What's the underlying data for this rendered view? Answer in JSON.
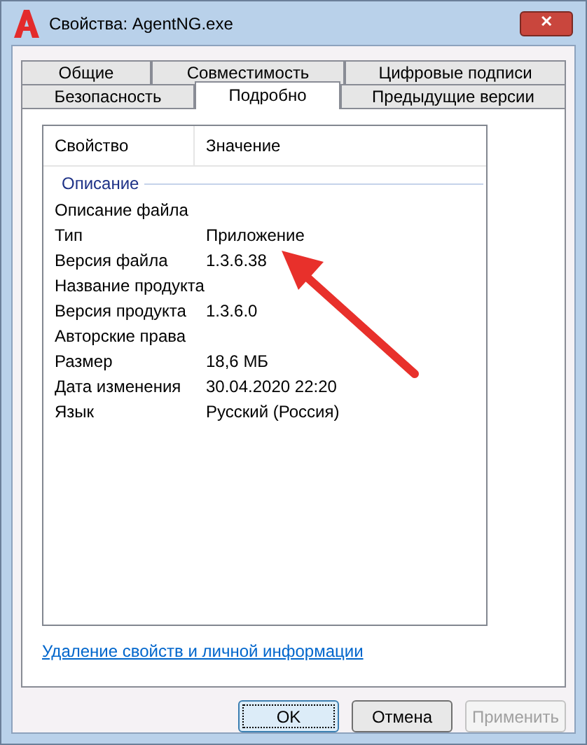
{
  "window": {
    "title": "Свойства: AgentNG.exe",
    "close": "✕"
  },
  "tab_rows": [
    [
      {
        "label": "Общие",
        "selected": false
      },
      {
        "label": "Совместимость",
        "selected": false
      },
      {
        "label": "Цифровые подписи",
        "selected": false
      }
    ],
    [
      {
        "label": "Безопасность",
        "selected": false
      },
      {
        "label": "Подробно",
        "selected": true
      },
      {
        "label": "Предыдущие версии",
        "selected": false
      }
    ]
  ],
  "table": {
    "columns": [
      "Свойство",
      "Значение"
    ],
    "group": "Описание",
    "rows": [
      {
        "name": "Описание файла",
        "value": ""
      },
      {
        "name": "Тип",
        "value": "Приложение"
      },
      {
        "name": "Версия файла",
        "value": "1.3.6.38"
      },
      {
        "name": "Название продукта",
        "value": ""
      },
      {
        "name": "Версия продукта",
        "value": "1.3.6.0"
      },
      {
        "name": "Авторские права",
        "value": ""
      },
      {
        "name": "Размер",
        "value": "18,6 МБ"
      },
      {
        "name": "Дата изменения",
        "value": "30.04.2020 22:20"
      },
      {
        "name": "Язык",
        "value": "Русский (Россия)"
      }
    ]
  },
  "link": "Удаление свойств и личной информации",
  "buttons": [
    {
      "label": "OK",
      "focused": true,
      "disabled": false
    },
    {
      "label": "Отмена",
      "focused": false,
      "disabled": false
    },
    {
      "label": "Применить",
      "focused": false,
      "disabled": true
    }
  ]
}
